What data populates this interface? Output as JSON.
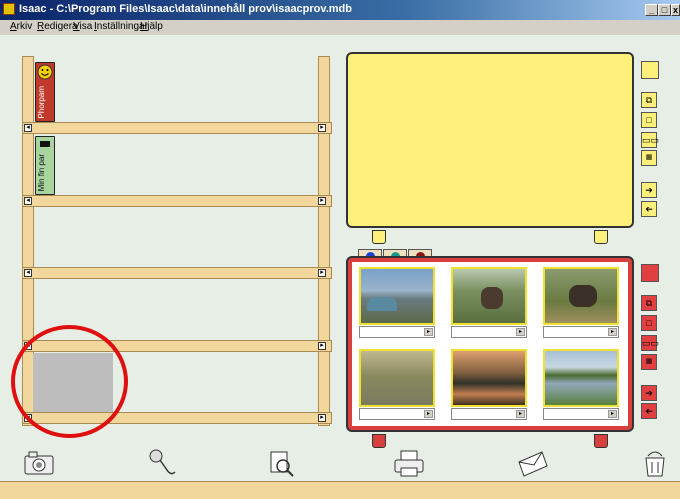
{
  "window": {
    "title": "Isaac - C:\\Program Files\\Isaac\\data\\innehåll prov\\isaacprov.mdb",
    "minimize_label": "_",
    "maximize_label": "□",
    "close_label": "x"
  },
  "menu": {
    "items": [
      "Arkiv",
      "Redigera",
      "Visa",
      "Inställningar",
      "Hjälp"
    ]
  },
  "shelf": {
    "books": [
      {
        "label": "Phorpam",
        "color": "#c0392b",
        "icon": "smiley-icon"
      },
      {
        "label": "Min fin par",
        "color": "#a8d4a0",
        "icon": "black-bar-icon"
      }
    ],
    "left_arrow": "◂",
    "right_arrow": "▸",
    "selected_slot_color": "#bdbdbd"
  },
  "viewer_top": {
    "color": "#fdf07a",
    "controls": [
      "layout-single-icon",
      "frame-icon",
      "two-grid-icon",
      "six-grid-icon",
      "arrow-right-icon",
      "arrow-left-icon"
    ]
  },
  "viewer_bottom": {
    "color": "#d84040",
    "tabs": [
      {
        "color": "#1a3fd8",
        "name": "blue"
      },
      {
        "color": "#1a9a8a",
        "name": "teal"
      },
      {
        "color": "#8a1010",
        "name": "darkred"
      }
    ],
    "photos": [
      {
        "caption": "",
        "scene": "tents-under-sky"
      },
      {
        "caption": "",
        "scene": "elephant-with-rider"
      },
      {
        "caption": "",
        "scene": "elephant-in-grass"
      },
      {
        "caption": "",
        "scene": "people-in-river"
      },
      {
        "caption": "",
        "scene": "sunset-over-water"
      },
      {
        "caption": "",
        "scene": "wetland-landscape"
      }
    ],
    "caption_button": "▸"
  },
  "bottom_toolbar": {
    "icons": [
      "camera-icon",
      "microphone-icon",
      "search-document-icon",
      "printer-icon",
      "envelope-icon",
      "trash-bin-icon"
    ]
  }
}
